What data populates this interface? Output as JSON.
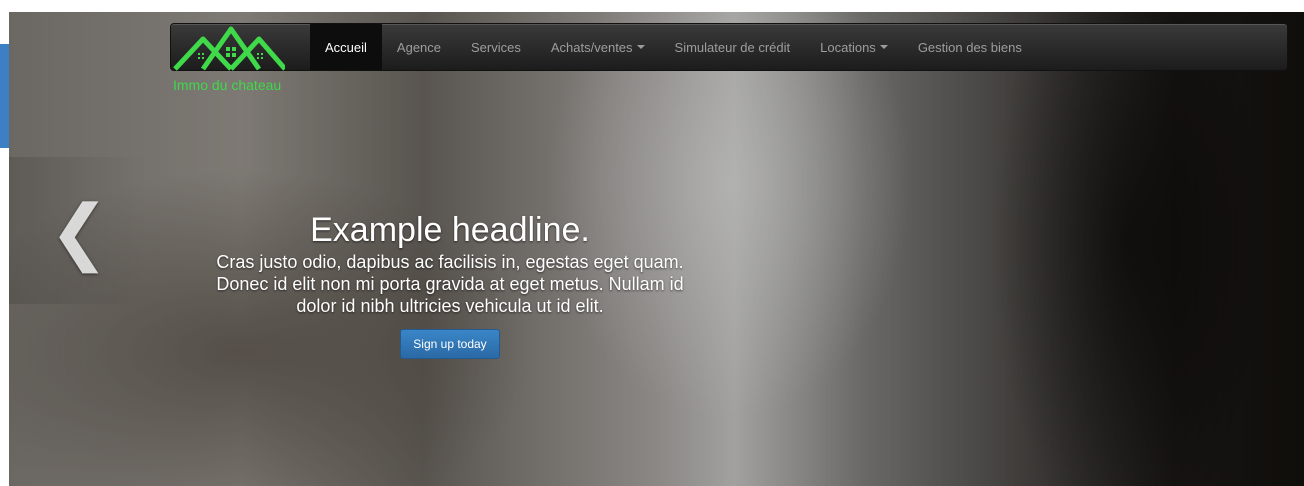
{
  "brand": {
    "name": "Immo du chateau",
    "logo_icon": "house-roofs-icon",
    "logo_color": "#3fd94a"
  },
  "nav": {
    "items": [
      {
        "label": "Accueil",
        "active": true
      },
      {
        "label": "Agence"
      },
      {
        "label": "Services"
      },
      {
        "label": "Achats/ventes",
        "dropdown": true
      },
      {
        "label": "Simulateur de crédit"
      },
      {
        "label": "Locations",
        "dropdown": true
      },
      {
        "label": "Gestion des biens"
      }
    ]
  },
  "carousel": {
    "prev_icon": "chevron-left-icon",
    "prev_glyph": "❮",
    "headline": "Example headline.",
    "text": "Cras justo odio, dapibus ac facilisis in, egestas eget quam. Donec id elit non mi porta gravida at eget metus. Nullam id dolor id nibh ultricies vehicula ut id elit.",
    "button_label": "Sign up today",
    "button_color": "#2f78b9"
  },
  "colors": {
    "accent_left": "#3d7fc4",
    "navbar": "#222222"
  }
}
